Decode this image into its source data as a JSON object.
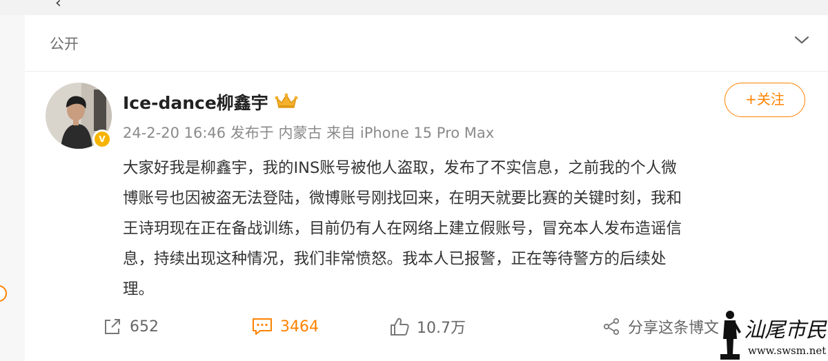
{
  "visibility": {
    "label": "公开"
  },
  "author": {
    "name": "Ice-dance柳鑫宇"
  },
  "meta": {
    "text": "24-2-20 16:46 发布于 内蒙古 来自 iPhone 15 Pro Max"
  },
  "follow": {
    "label": "+关注"
  },
  "post": {
    "lines": [
      "大家好我是柳鑫宇，我的INS账号被他人盗取，发布了不实信息，之前我的个人微",
      "博账号也因被盗无法登陆，微博账号刚找回来，在明天就要比赛的关键时刻，我和",
      "王诗玥现在正在备战训练，目前仍有人在网络上建立假账号，冒充本人发布造谣信",
      "息，持续出现这种情况，我们非常愤怒。我本人已报警，正在等待警方的后续处",
      "理。"
    ]
  },
  "actions": {
    "repost_count": "652",
    "comment_count": "3464",
    "like_count": "10.7万",
    "share_label": "分享这条博文"
  },
  "watermark": {
    "text": "汕尾市民网",
    "url": "www.swsm.net"
  },
  "colors": {
    "accent": "#ff8200",
    "verified": "#f6b400"
  }
}
